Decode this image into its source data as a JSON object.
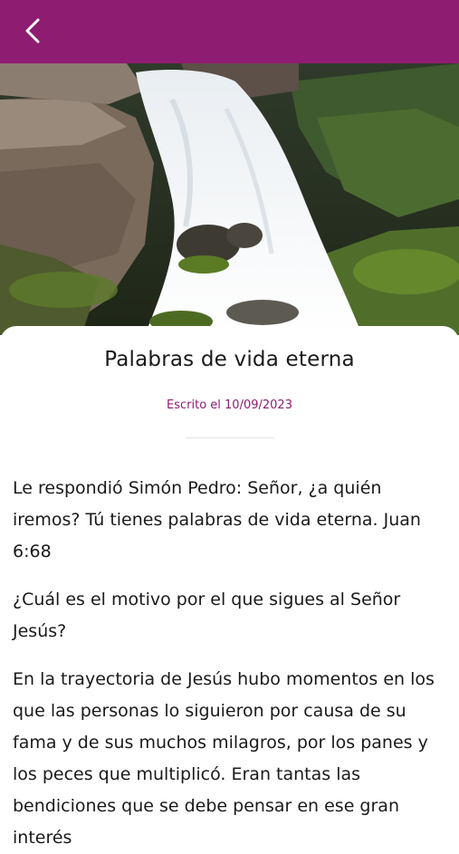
{
  "header": {
    "back_icon": "chevron-left-icon",
    "background": "#8e1d72"
  },
  "hero": {
    "subject": "waterfall-photo"
  },
  "article": {
    "title": "Palabras de vida eterna",
    "date": "Escrito el 10/09/2023",
    "paragraphs": [
      "Le respondió Simón Pedro: Señor, ¿a quién iremos? Tú tienes palabras de vida eterna. Juan 6:68",
      "¿Cuál es el motivo por el que sigues al Señor Jesús?",
      "En la trayectoria de Jesús hubo momentos en los que las personas lo siguieron por causa de su fama y de sus muchos milagros, por los panes y los peces que multiplicó. Eran tantas las bendiciones que se debe pensar en ese gran interés"
    ]
  },
  "colors": {
    "accent": "#8e1d72",
    "text": "#1a1a1a"
  }
}
